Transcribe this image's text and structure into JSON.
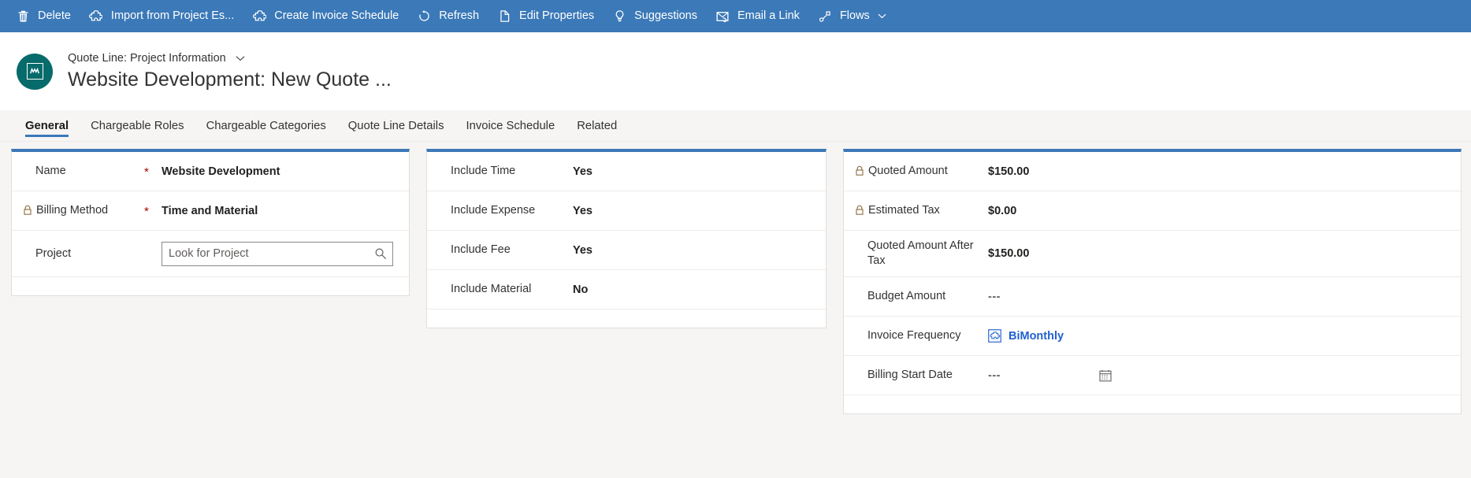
{
  "command_bar": {
    "background": "#3b79b8",
    "items": [
      {
        "label": "Delete",
        "icon": "trash-icon",
        "caret": false
      },
      {
        "label": "Import from Project Es...",
        "icon": "puzzle-icon",
        "caret": false
      },
      {
        "label": "Create Invoice Schedule",
        "icon": "puzzle-icon",
        "caret": false
      },
      {
        "label": "Refresh",
        "icon": "refresh-icon",
        "caret": false
      },
      {
        "label": "Edit Properties",
        "icon": "page-edit-icon",
        "caret": false
      },
      {
        "label": "Suggestions",
        "icon": "lightbulb-icon",
        "caret": false
      },
      {
        "label": "Email a Link",
        "icon": "email-link-icon",
        "caret": false
      },
      {
        "label": "Flows",
        "icon": "flows-icon",
        "caret": true
      }
    ]
  },
  "header": {
    "entity_label": "Quote Line: Project Information",
    "record_title": "Website Development: New Quote ...",
    "avatar_color": "#076b6b",
    "avatar_icon": "quote-line-icon",
    "dropdown_icon": "chevron-down-icon"
  },
  "tabs": {
    "selected_index": 0,
    "accent": "#3b79b8",
    "items": [
      {
        "label": "General"
      },
      {
        "label": "Chargeable Roles"
      },
      {
        "label": "Chargeable Categories"
      },
      {
        "label": "Quote Line Details"
      },
      {
        "label": "Invoice Schedule"
      },
      {
        "label": "Related"
      }
    ]
  },
  "columns": {
    "left": {
      "fields": [
        {
          "label": "Name",
          "required": true,
          "locked": false,
          "type": "text",
          "value": "Website Development"
        },
        {
          "label": "Billing Method",
          "required": true,
          "locked": true,
          "type": "text",
          "value": "Time and Material"
        },
        {
          "label": "Project",
          "required": false,
          "locked": false,
          "type": "lookup",
          "value": "",
          "placeholder": "Look for Project",
          "search_icon": "search-icon"
        }
      ]
    },
    "middle": {
      "fields": [
        {
          "label": "Include Time",
          "required": false,
          "locked": false,
          "type": "text",
          "value": "Yes"
        },
        {
          "label": "Include Expense",
          "required": false,
          "locked": false,
          "type": "text",
          "value": "Yes"
        },
        {
          "label": "Include Fee",
          "required": false,
          "locked": false,
          "type": "text",
          "value": "Yes"
        },
        {
          "label": "Include Material",
          "required": false,
          "locked": false,
          "type": "text",
          "value": "No"
        }
      ]
    },
    "right": {
      "fields": [
        {
          "label": "Quoted Amount",
          "required": false,
          "locked": true,
          "type": "text",
          "value": "$150.00"
        },
        {
          "label": "Estimated Tax",
          "required": false,
          "locked": true,
          "type": "text",
          "value": "$0.00"
        },
        {
          "label": "Quoted Amount After Tax",
          "required": false,
          "locked": false,
          "type": "text",
          "value": "$150.00",
          "two_line": true
        },
        {
          "label": "Budget Amount",
          "required": false,
          "locked": false,
          "type": "empty",
          "value": "---"
        },
        {
          "label": "Invoice Frequency",
          "required": false,
          "locked": false,
          "type": "link",
          "value": "BiMonthly",
          "entity_icon": "invoice-frequency-icon",
          "link_color": "#1f5fd0"
        },
        {
          "label": "Billing Start Date",
          "required": false,
          "locked": false,
          "type": "date",
          "value": "---",
          "calendar_icon": "calendar-icon"
        }
      ]
    }
  }
}
